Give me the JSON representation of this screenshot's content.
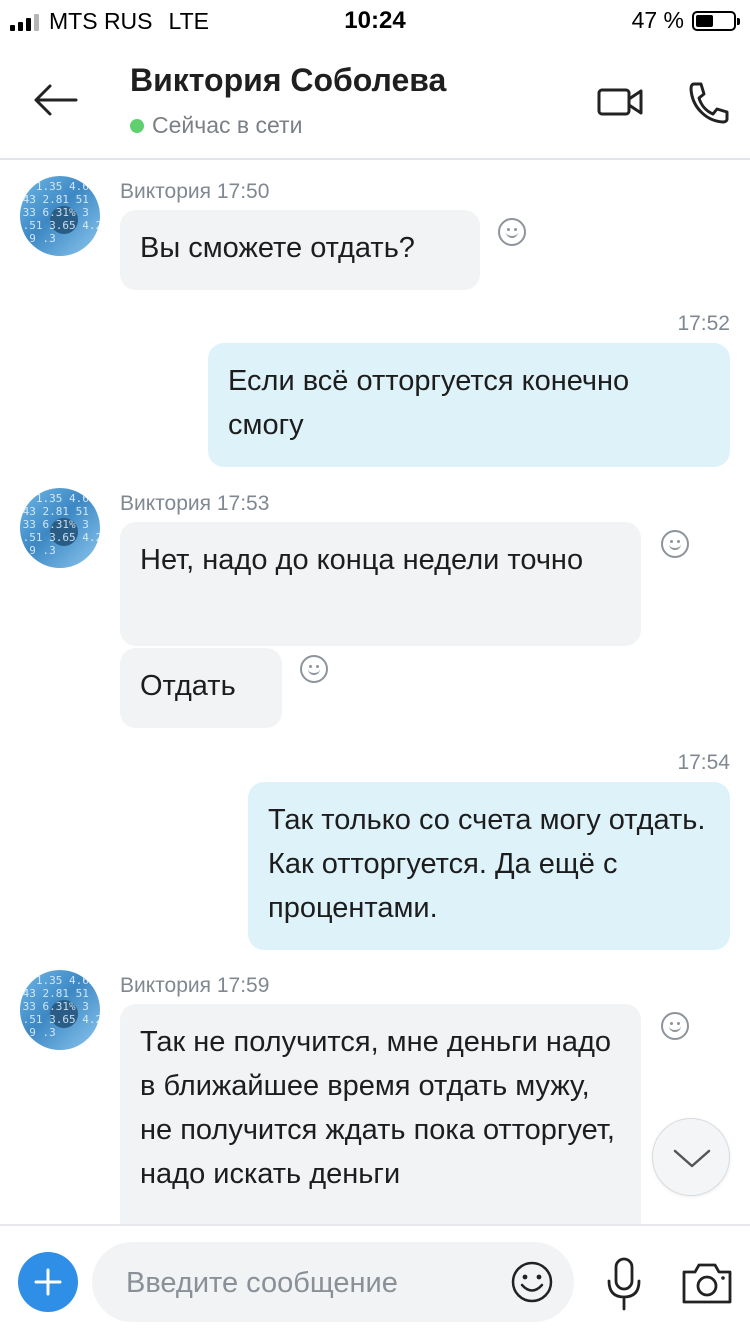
{
  "status_bar": {
    "carrier": "MTS RUS",
    "network": "LTE",
    "time": "10:24",
    "battery": "47 %",
    "battery_level": 0.47
  },
  "header": {
    "contact_name": "Виктория Соболева",
    "presence": "Сейчас в сети",
    "presence_color": "#5fcf6f"
  },
  "messages": [
    {
      "meta": "Виктория 17:50",
      "text": "Вы сможете отдать?"
    },
    {
      "meta": "17:52",
      "text": "Если всё отторгуется конечно смогу"
    },
    {
      "meta": "Виктория 17:53",
      "text": "Нет, надо до конца недели точно"
    },
    {
      "text": "Отдать"
    },
    {
      "meta": "17:54",
      "text": "Так только со счета могу отдать. Как отторгуется. Да ещё с процентами."
    },
    {
      "meta": "Виктория 17:59",
      "text": "Так не получится, мне деньги надо в ближайшее время отдать мужу, не получится ждать пока отторгует, надо искать деньги"
    }
  ],
  "composer": {
    "placeholder": "Введите сообщение"
  },
  "colors": {
    "accent": "#2f8ee6",
    "incoming_bubble": "#f1f3f5",
    "outgoing_bubble": "#def2fa"
  }
}
